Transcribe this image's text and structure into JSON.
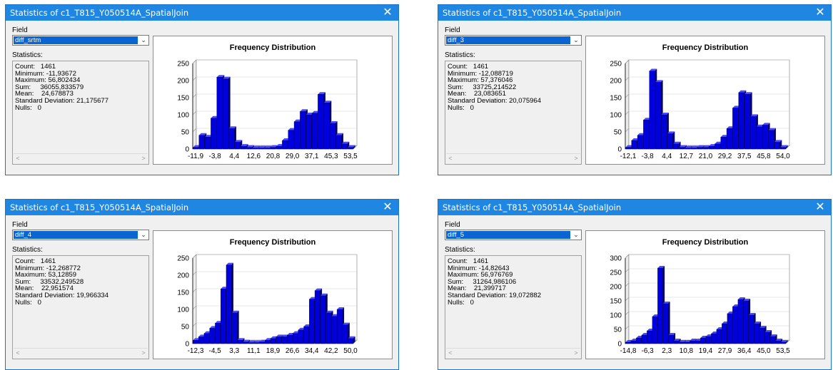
{
  "windows": [
    {
      "title": "Statistics of c1_T815_Y050514A_SpatialJoin",
      "close_glyph": "✕",
      "field_label": "Field",
      "field_value": "diff_srtm",
      "stats_label": "Statistics:",
      "stats_text": "Count:   1461\nMinimum: -11,93672\nMaximum: 56,802434\nSum:     36055,833579\nMean:    24,678873\nStandard Deviation: 21,175677\nNulls:   0",
      "chart_title": "Frequency Distribution"
    },
    {
      "title": "Statistics of c1_T815_Y050514A_SpatialJoin",
      "close_glyph": "✕",
      "field_label": "Field",
      "field_value": "diff_3",
      "stats_label": "Statistics:",
      "stats_text": "Count:   1461\nMinimum: -12,088719\nMaximum: 57,376046\nSum:     33725,214522\nMean:    23,083651\nStandard Deviation: 20,075964\nNulls:   0",
      "chart_title": "Frequency Distribution"
    },
    {
      "title": "Statistics of c1_T815_Y050514A_SpatialJoin",
      "close_glyph": "✕",
      "field_label": "Field",
      "field_value": "diff_4",
      "stats_label": "Statistics:",
      "stats_text": "Count:   1461\nMinimum: -12,268772\nMaximum: 53,12859\nSum:     33532,249528\nMean:    22,951574\nStandard Deviation: 19,966334\nNulls:   0",
      "chart_title": "Frequency Distribution"
    },
    {
      "title": "Statistics of c1_T815_Y050514A_SpatialJoin",
      "close_glyph": "✕",
      "field_label": "Field",
      "field_value": "diff_5",
      "stats_label": "Statistics:",
      "stats_text": "Count:   1461\nMinimum: -14,82643\nMaximum: 56,976769\nSum:     31264,986106\nMean:    21,399717\nStandard Deviation: 19,072882\nNulls:   0",
      "chart_title": "Frequency Distribution"
    }
  ],
  "chart_data": [
    {
      "type": "bar",
      "title": "Frequency Distribution",
      "bar_color": "#0000dd",
      "ylim": [
        0,
        250
      ],
      "yticks": [
        0,
        50,
        100,
        150,
        200,
        250
      ],
      "xtick_labels": [
        "-11,9",
        "-3,8",
        "4,4",
        "12,6",
        "20,8",
        "29,0",
        "37,1",
        "45,3",
        "53,5"
      ],
      "values": [
        5,
        40,
        35,
        90,
        210,
        205,
        60,
        20,
        8,
        5,
        3,
        3,
        3,
        5,
        8,
        25,
        55,
        80,
        110,
        100,
        105,
        160,
        135,
        75,
        40,
        15,
        5
      ]
    },
    {
      "type": "bar",
      "title": "Frequency Distribution",
      "bar_color": "#0000dd",
      "ylim": [
        0,
        250
      ],
      "yticks": [
        0,
        50,
        100,
        150,
        200,
        250
      ],
      "xtick_labels": [
        "-12,1",
        "-3,8",
        "4,4",
        "12,7",
        "21,0",
        "29,2",
        "37,5",
        "45,8",
        "54,0"
      ],
      "values": [
        5,
        25,
        40,
        85,
        228,
        195,
        100,
        45,
        15,
        5,
        3,
        3,
        5,
        5,
        8,
        15,
        35,
        60,
        120,
        165,
        160,
        95,
        65,
        70,
        55,
        20,
        5
      ]
    },
    {
      "type": "bar",
      "title": "Frequency Distribution",
      "bar_color": "#0000dd",
      "ylim": [
        0,
        250
      ],
      "yticks": [
        0,
        50,
        100,
        150,
        200,
        250
      ],
      "xtick_labels": [
        "-12,3",
        "-4,5",
        "3,3",
        "11,1",
        "18,9",
        "26,6",
        "34,4",
        "42,2",
        "50,0"
      ],
      "values": [
        10,
        20,
        30,
        45,
        60,
        160,
        230,
        90,
        10,
        5,
        3,
        3,
        5,
        10,
        15,
        20,
        20,
        25,
        30,
        40,
        50,
        130,
        155,
        140,
        90,
        80,
        100,
        55,
        15
      ]
    },
    {
      "type": "bar",
      "title": "Frequency Distribution",
      "bar_color": "#0000dd",
      "ylim": [
        0,
        300
      ],
      "yticks": [
        0,
        50,
        100,
        150,
        200,
        250,
        300
      ],
      "xtick_labels": [
        "-14,8",
        "-6,3",
        "2,3",
        "10,8",
        "19,4",
        "27,9",
        "36,4",
        "45,0",
        "53,5"
      ],
      "values": [
        5,
        10,
        20,
        30,
        45,
        95,
        265,
        140,
        30,
        10,
        5,
        5,
        10,
        10,
        20,
        25,
        35,
        50,
        70,
        105,
        130,
        155,
        150,
        100,
        70,
        55,
        40,
        25,
        10,
        5
      ]
    }
  ]
}
